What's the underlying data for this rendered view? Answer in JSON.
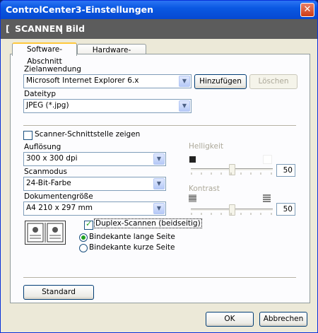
{
  "window": {
    "title": "ControlCenter3-Einstellungen",
    "close_icon": "close-icon"
  },
  "header": {
    "bracket_open": "[",
    "scan": "SCANNEN",
    "separator": "|",
    "image": "Bild",
    "bracket_close": "]"
  },
  "tabs": [
    {
      "label": "Software-Abschnitt",
      "active": true
    },
    {
      "label": "Hardware-Abschnitt",
      "active": false
    }
  ],
  "target": {
    "label": "Zielanwendung",
    "value": "Microsoft Internet Explorer 6.x",
    "add_button": "Hinzufügen",
    "delete_button": "Löschen"
  },
  "filetype": {
    "label": "Dateityp",
    "value": "JPEG (*.jpg)"
  },
  "scanner_ui": {
    "label": "Scanner-Schnittstelle zeigen",
    "checked": false
  },
  "resolution": {
    "label": "Auflösung",
    "value": "300 x 300 dpi"
  },
  "scanmode": {
    "label": "Scanmodus",
    "value": "24-Bit-Farbe"
  },
  "docsize": {
    "label": "Dokumentengröße",
    "value": "A4 210 x 297 mm"
  },
  "brightness": {
    "label": "Helligkeit",
    "value": "50",
    "level": 0.5
  },
  "contrast": {
    "label": "Kontrast",
    "value": "50",
    "level": 0.5
  },
  "duplex": {
    "label": "Duplex-Scannen (beidseitig)",
    "checked": true,
    "icon": "duplex-book-icon"
  },
  "binding": {
    "long_edge": "Bindekante lange Seite",
    "short_edge": "Bindekante kurze Seite",
    "selected": "long_edge"
  },
  "footer": {
    "default_button": "Standard",
    "ok_button": "OK",
    "cancel_button": "Abbrechen"
  }
}
